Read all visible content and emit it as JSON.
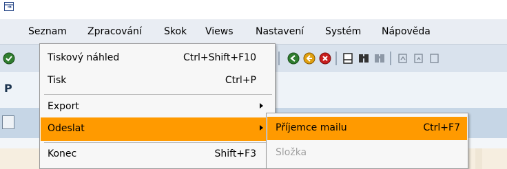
{
  "menubar": {
    "items": [
      {
        "label": "Seznam",
        "id": "seznam"
      },
      {
        "label": "Zpracování",
        "id": "zpracovani"
      },
      {
        "label": "Skok",
        "id": "skok"
      },
      {
        "label": "Views",
        "id": "views"
      },
      {
        "label": "Nastavení",
        "id": "nastaveni"
      },
      {
        "label": "Systém",
        "id": "system"
      },
      {
        "label": "Nápověda",
        "id": "napoveda"
      }
    ]
  },
  "title": {
    "visible_text": "P"
  },
  "dropdown": {
    "items": [
      {
        "label": "Tiskový náhled",
        "shortcut": "Ctrl+Shift+F10"
      },
      {
        "label": "Tisk",
        "shortcut": "Ctrl+P"
      },
      {
        "label": "Export",
        "shortcut": ""
      },
      {
        "label": "Odeslat",
        "shortcut": ""
      },
      {
        "label": "Konec",
        "shortcut": "Shift+F3"
      }
    ]
  },
  "submenu": {
    "items": [
      {
        "label": "Příjemce mailu",
        "shortcut": "Ctrl+F7"
      },
      {
        "label": "Složka",
        "shortcut": ""
      }
    ]
  },
  "colors": {
    "highlight": "#ff9a00",
    "menu_bg": "#f7f7f7",
    "toolbar_bg": "#d9e2ed"
  },
  "toolbar": {
    "icons": [
      "enter-icon",
      "back-icon",
      "exit-icon",
      "cancel-icon",
      "print-icon",
      "find-icon",
      "find-next-icon",
      "first-page-icon",
      "previous-page-icon",
      "next-page-icon"
    ]
  }
}
